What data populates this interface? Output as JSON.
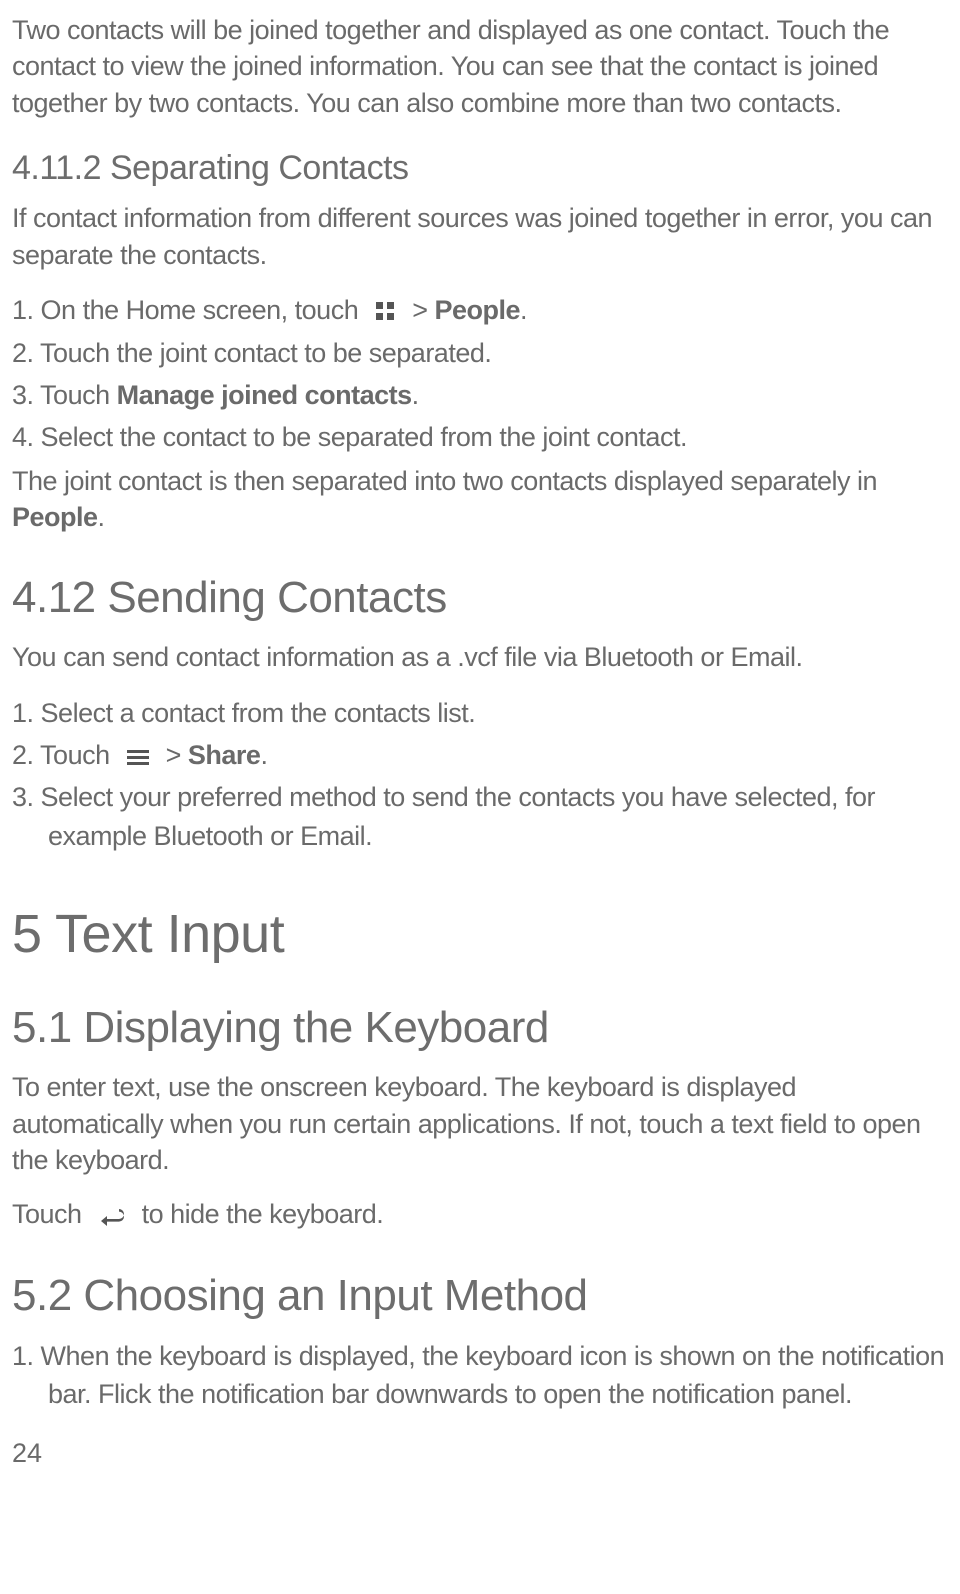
{
  "intro_para": "Two contacts will be joined together and displayed as one contact. Touch the contact to view the joined information. You can see that the contact is joined together by two contacts. You can also combine more than two contacts.",
  "sec_4_11_2": {
    "heading": "4.11.2  Separating Contacts",
    "para": "If contact information from different sources was joined together in error, you can separate the contacts.",
    "step1_a": "On the Home screen, touch",
    "step1_b": " > ",
    "step1_bold": "People",
    "step1_c": ".",
    "step2": "Touch the joint contact to be separated.",
    "step3_a": "Touch ",
    "step3_bold": "Manage joined contacts",
    "step3_b": ".",
    "step4": "Select the contact to be separated from the joint contact.",
    "follow_a": "The joint contact is then separated into two contacts displayed separately in ",
    "follow_bold": "People",
    "follow_b": "."
  },
  "sec_4_12": {
    "heading": "4.12  Sending Contacts",
    "para": "You can send contact information as a .vcf file via Bluetooth or Email.",
    "step1": "Select a contact from the contacts list.",
    "step2_a": "Touch",
    "step2_b": " > ",
    "step2_bold": "Share",
    "step2_c": ".",
    "step3": "Select your preferred method to send the contacts you have selected, for example Bluetooth or Email."
  },
  "sec_5": {
    "heading": "5  Text Input"
  },
  "sec_5_1": {
    "heading": "5.1  Displaying the Keyboard",
    "para1": "To enter text, use the onscreen keyboard. The keyboard is displayed automatically when you run certain applications. If not, touch a text field to open the keyboard.",
    "para2_a": "Touch",
    "para2_b": " to hide the keyboard."
  },
  "sec_5_2": {
    "heading": "5.2  Choosing an Input Method",
    "step1": "When the keyboard is displayed, the keyboard icon is shown on the notification bar. Flick the notification bar downwards to open the notification panel."
  },
  "page_number": "24"
}
